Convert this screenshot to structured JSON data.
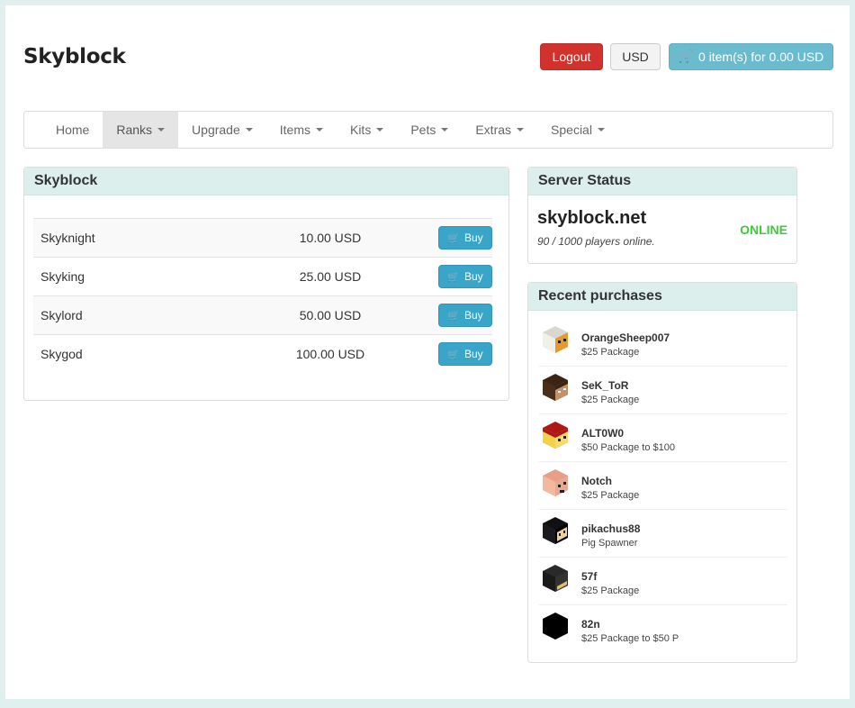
{
  "header": {
    "brand": "Skyblock",
    "logout_label": "Logout",
    "currency_label": "USD",
    "cart_icon": "cart-icon",
    "cart_label": "0 item(s) for 0.00 USD"
  },
  "nav": {
    "items": [
      {
        "label": "Home",
        "dropdown": false,
        "active": false
      },
      {
        "label": "Ranks",
        "dropdown": true,
        "active": true
      },
      {
        "label": "Upgrade",
        "dropdown": true,
        "active": false
      },
      {
        "label": "Items",
        "dropdown": true,
        "active": false
      },
      {
        "label": "Kits",
        "dropdown": true,
        "active": false
      },
      {
        "label": "Pets",
        "dropdown": true,
        "active": false
      },
      {
        "label": "Extras",
        "dropdown": true,
        "active": false
      },
      {
        "label": "Special",
        "dropdown": true,
        "active": false
      }
    ]
  },
  "packages": {
    "title": "Skyblock",
    "buy_label": "Buy",
    "rows": [
      {
        "name": "Skyknight",
        "price": "10.00 USD"
      },
      {
        "name": "Skyking",
        "price": "25.00 USD"
      },
      {
        "name": "Skylord",
        "price": "50.00 USD"
      },
      {
        "name": "Skygod",
        "price": "100.00 USD"
      }
    ]
  },
  "server_status": {
    "title": "Server Status",
    "server": "skyblock.net",
    "players": "90 / 1000 players online.",
    "state": "ONLINE",
    "state_color": "#3ec93a"
  },
  "recent": {
    "title": "Recent purchases",
    "items": [
      {
        "name": "OrangeSheep007",
        "package": "$25 Package",
        "skin": "sheep"
      },
      {
        "name": "SeK_ToR",
        "package": "$25 Package",
        "skin": "steve"
      },
      {
        "name": "ALT0W0",
        "package": "$50 Package to $100",
        "skin": "santa"
      },
      {
        "name": "Notch",
        "package": "$25 Package",
        "skin": "pig"
      },
      {
        "name": "pikachus88",
        "package": "Pig Spawner",
        "skin": "black-hood"
      },
      {
        "name": "57f",
        "package": "$25 Package",
        "skin": "dark"
      },
      {
        "name": "82n",
        "package": "$25 Package to $50 P",
        "skin": "black"
      }
    ]
  },
  "colors": {
    "accent": "#6bbbce",
    "logout": "#d2322d",
    "buy": "#39a6c9",
    "panel_heading": "#ddefed"
  }
}
